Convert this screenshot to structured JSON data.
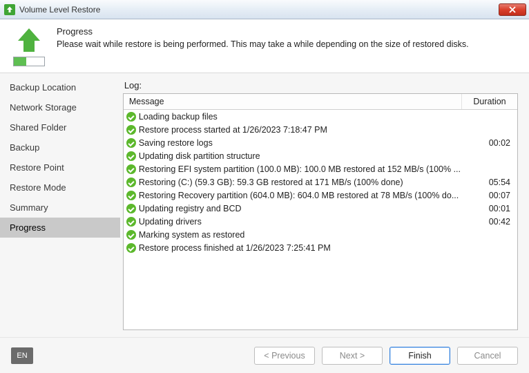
{
  "titlebar": {
    "title": "Volume Level Restore"
  },
  "header": {
    "title": "Progress",
    "desc": "Please wait while restore is being performed. This may take a while depending on the size of restored disks."
  },
  "sidebar": {
    "items": [
      {
        "label": "Backup Location"
      },
      {
        "label": "Network Storage"
      },
      {
        "label": "Shared Folder"
      },
      {
        "label": "Backup"
      },
      {
        "label": "Restore Point"
      },
      {
        "label": "Restore Mode"
      },
      {
        "label": "Summary"
      },
      {
        "label": "Progress",
        "active": true
      }
    ]
  },
  "log": {
    "label": "Log:",
    "columns": {
      "message": "Message",
      "duration": "Duration"
    },
    "rows": [
      {
        "message": "Loading backup files",
        "duration": ""
      },
      {
        "message": "Restore process started at 1/26/2023 7:18:47 PM",
        "duration": ""
      },
      {
        "message": "Saving restore logs",
        "duration": "00:02"
      },
      {
        "message": "Updating disk partition structure",
        "duration": ""
      },
      {
        "message": "Restoring EFI system partition (100.0 MB): 100.0 MB restored at 152 MB/s (100% ...",
        "duration": ""
      },
      {
        "message": "Restoring (C:) (59.3 GB): 59.3 GB restored at 171 MB/s (100% done)",
        "duration": "05:54"
      },
      {
        "message": "Restoring Recovery partition (604.0 MB): 604.0 MB restored at 78 MB/s (100% do...",
        "duration": "00:07"
      },
      {
        "message": "Updating registry and BCD",
        "duration": "00:01"
      },
      {
        "message": "Updating drivers",
        "duration": "00:42"
      },
      {
        "message": "Marking system as restored",
        "duration": ""
      },
      {
        "message": "Restore process finished at 1/26/2023 7:25:41 PM",
        "duration": ""
      }
    ]
  },
  "footer": {
    "lang": "EN",
    "buttons": {
      "previous": "< Previous",
      "next": "Next >",
      "finish": "Finish",
      "cancel": "Cancel"
    }
  }
}
